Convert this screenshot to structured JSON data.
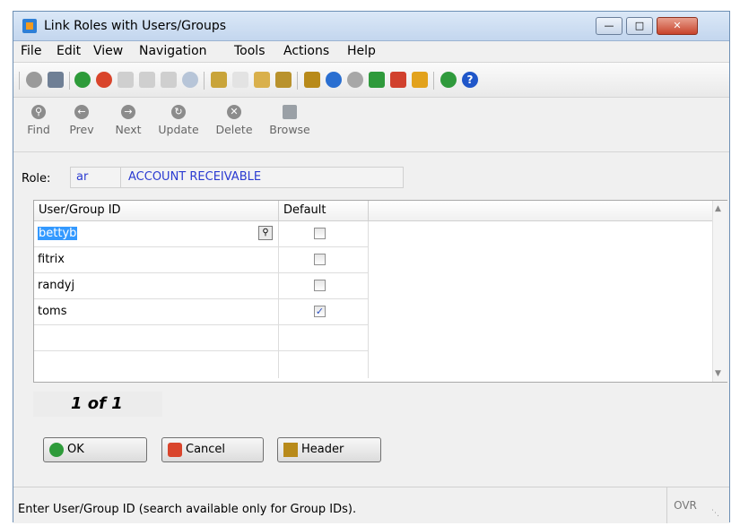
{
  "window": {
    "title": "Link Roles with Users/Groups"
  },
  "menu": [
    "File",
    "Edit",
    "View",
    "Navigation",
    "Tools",
    "Actions",
    "Help"
  ],
  "nav_buttons": [
    "Find",
    "Prev",
    "Next",
    "Update",
    "Delete",
    "Browse"
  ],
  "role": {
    "label": "Role:",
    "code": "ar",
    "description": "ACCOUNT RECEIVABLE"
  },
  "grid": {
    "headers": {
      "id": "User/Group ID",
      "default": "Default"
    },
    "rows": [
      {
        "id": "bettyb",
        "default": false
      },
      {
        "id": "fitrix",
        "default": false
      },
      {
        "id": "randyj",
        "default": false
      },
      {
        "id": "toms",
        "default": true
      }
    ]
  },
  "record_count": "1 of 1",
  "buttons": {
    "ok": "OK",
    "cancel": "Cancel",
    "header": "Header"
  },
  "status": {
    "message": "Enter User/Group ID (search available only for Group IDs).",
    "mode": "OVR"
  },
  "colors": {
    "accent_blue": "#2b3bd1",
    "selection": "#3399ff"
  }
}
